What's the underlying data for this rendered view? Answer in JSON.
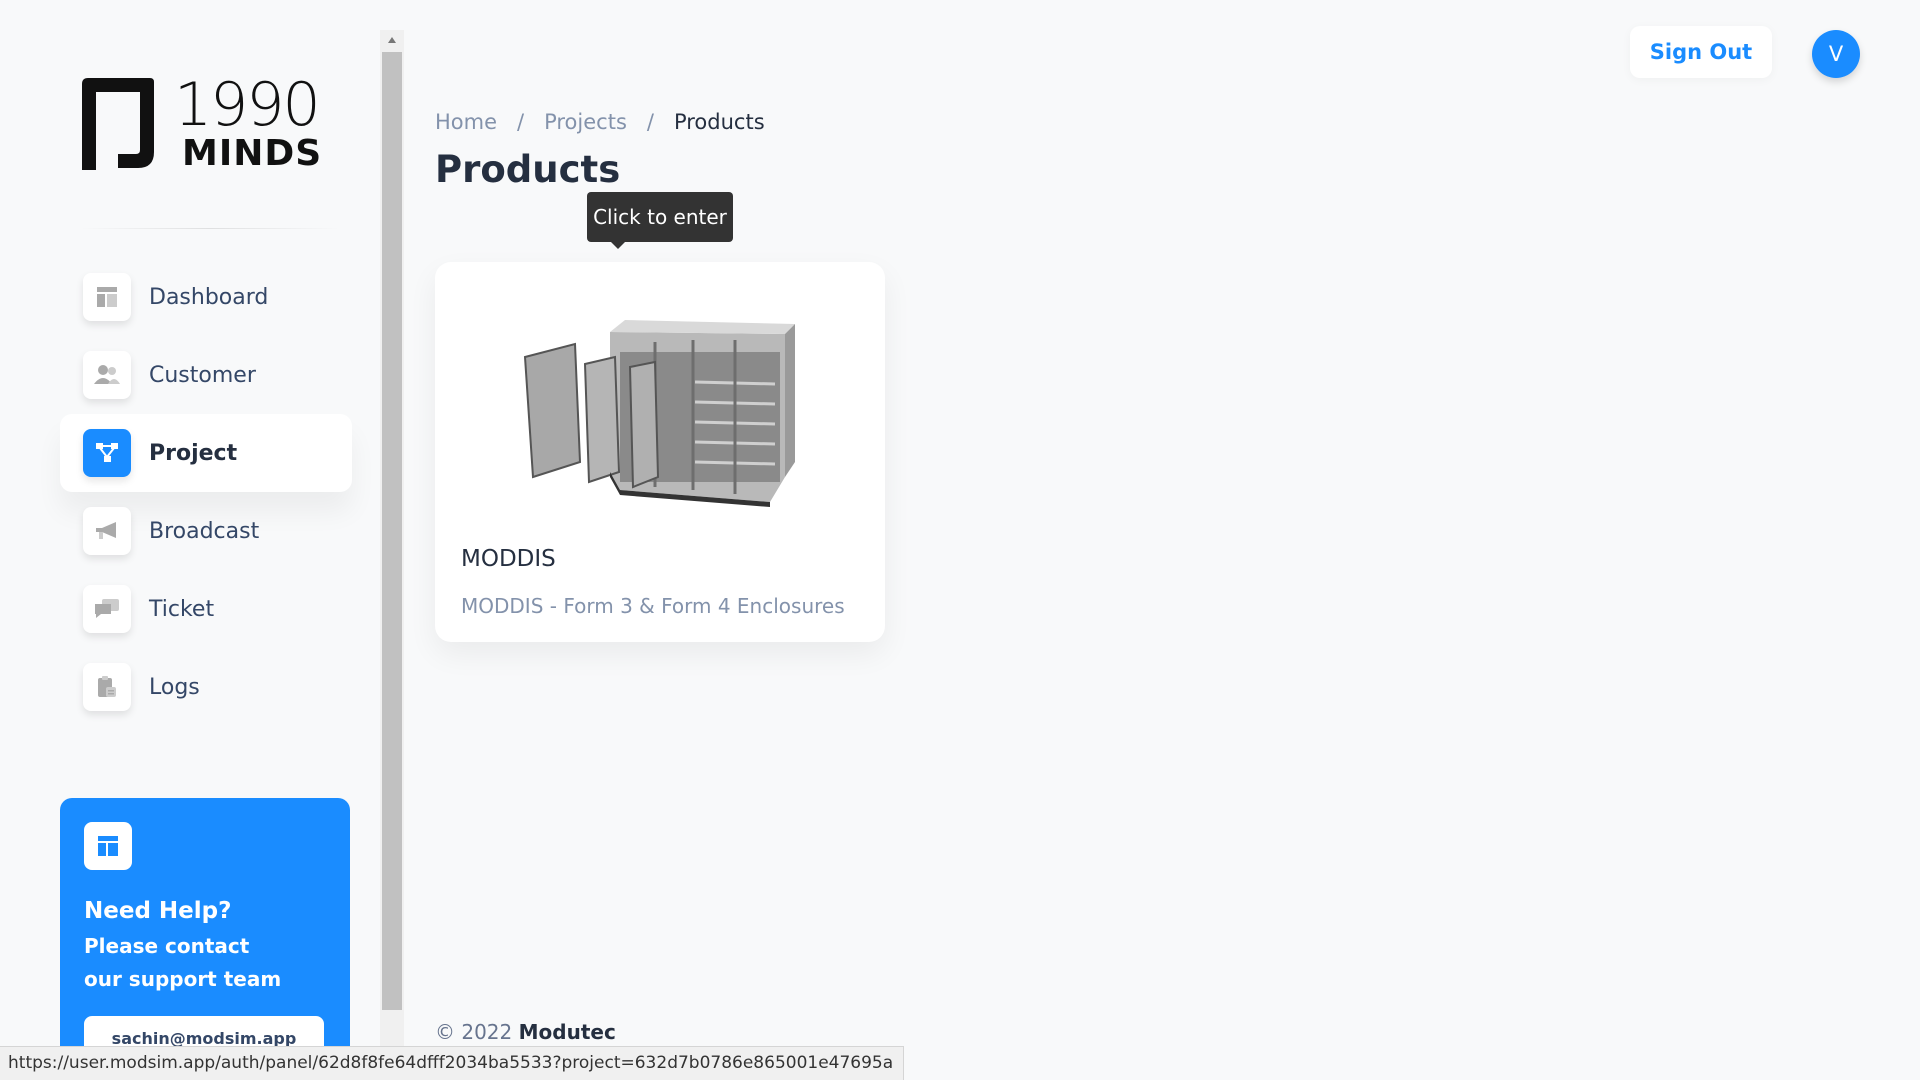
{
  "brand": {
    "logo_top": "1990",
    "logo_bottom": "MINDS"
  },
  "sidebar": {
    "items": [
      {
        "label": "Dashboard",
        "icon": "dashboard-icon"
      },
      {
        "label": "Customer",
        "icon": "users-icon"
      },
      {
        "label": "Project",
        "icon": "project-icon",
        "active": true
      },
      {
        "label": "Broadcast",
        "icon": "megaphone-icon"
      },
      {
        "label": "Ticket",
        "icon": "chat-icon"
      },
      {
        "label": "Logs",
        "icon": "clipboard-icon"
      }
    ],
    "help": {
      "title": "Need Help?",
      "text": "Please contact our support team",
      "button": "sachin@modsim.app"
    }
  },
  "header": {
    "signout_label": "Sign Out",
    "avatar_initial": "V"
  },
  "breadcrumb": {
    "items": [
      "Home",
      "Projects",
      "Products"
    ],
    "separator": "/"
  },
  "page_title": "Products",
  "tooltip": "Click to enter",
  "products": [
    {
      "name": "MODDIS",
      "description": "MODDIS - Form 3 & Form 4 Enclosures"
    }
  ],
  "footer": {
    "copyright": "© 2022",
    "company": "Modutec"
  },
  "status_url": "https://user.modsim.app/auth/panel/62d8f8fe64dfff2034ba5533?project=632d7b0786e865001e47695a",
  "colors": {
    "accent": "#1a8cff",
    "text_dark": "#252f40",
    "text_muted": "#8392ab",
    "background": "#f8f9fa"
  }
}
